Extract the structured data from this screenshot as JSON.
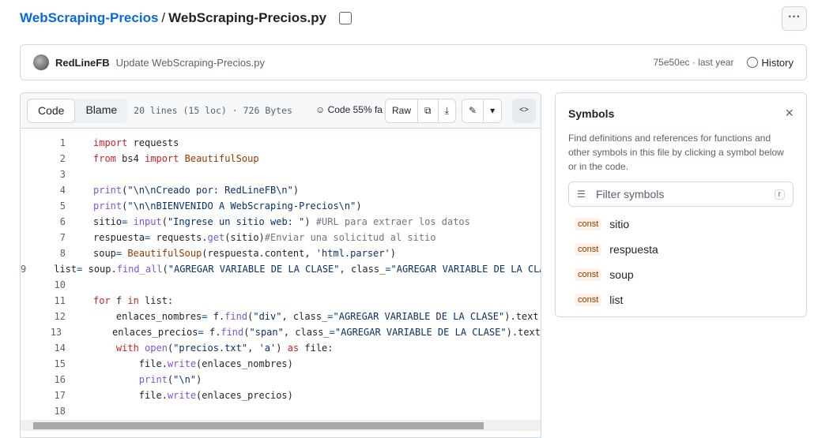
{
  "breadcrumb": {
    "repo": "WebScraping-Precios",
    "separator": "/",
    "file": "WebScraping-Precios.py"
  },
  "more_label": "···",
  "commit": {
    "author": "RedLineFB",
    "message": "Update WebScraping-Precios.py",
    "hash_time": "75e50ec · last year",
    "history": "History"
  },
  "toolbar": {
    "code_tab": "Code",
    "blame_tab": "Blame",
    "meta": "20 lines (15 loc) · 726 Bytes",
    "copilot": "Code 55% fa",
    "raw": "Raw",
    "overflow_text": "Co"
  },
  "code": [
    {
      "n": "1",
      "t": [
        [
          "import",
          "k"
        ],
        [
          " requests",
          ""
        ]
      ]
    },
    {
      "n": "2",
      "t": [
        [
          "from",
          "k"
        ],
        [
          " bs4 ",
          ""
        ],
        [
          "import",
          "k"
        ],
        [
          " ",
          ""
        ],
        [
          "BeautifulSoup",
          "c"
        ]
      ]
    },
    {
      "n": "3",
      "t": []
    },
    {
      "n": "4",
      "t": [
        [
          "print",
          "f"
        ],
        [
          "(",
          ""
        ],
        [
          "\"\\n\\nCreado por: RedLineFB\\n\"",
          "s"
        ],
        [
          ")",
          ""
        ]
      ]
    },
    {
      "n": "5",
      "t": [
        [
          "print",
          "f"
        ],
        [
          "(",
          ""
        ],
        [
          "\"\\n\\nBIENVENIDO A WebScraping-Precios\\n\"",
          "s"
        ],
        [
          ")",
          ""
        ]
      ]
    },
    {
      "n": "6",
      "t": [
        [
          "sitio",
          ""
        ],
        [
          "=",
          "o"
        ],
        [
          " ",
          ""
        ],
        [
          "input",
          "f"
        ],
        [
          "(",
          ""
        ],
        [
          "\"Ingrese un sitio web: \"",
          "s"
        ],
        [
          ") ",
          ""
        ],
        [
          "#URL para extraer los datos",
          "m"
        ]
      ]
    },
    {
      "n": "7",
      "t": [
        [
          "respuesta",
          ""
        ],
        [
          "=",
          "o"
        ],
        [
          " requests.",
          ""
        ],
        [
          "get",
          "f"
        ],
        [
          "(sitio)",
          ""
        ],
        [
          "#Enviar una solicitud al sitio",
          "m"
        ]
      ]
    },
    {
      "n": "8",
      "t": [
        [
          "soup",
          ""
        ],
        [
          "=",
          "o"
        ],
        [
          " ",
          ""
        ],
        [
          "BeautifulSoup",
          "c"
        ],
        [
          "(respuesta.content, ",
          ""
        ],
        [
          "'html.parser'",
          "s"
        ],
        [
          ")",
          ""
        ]
      ]
    },
    {
      "n": "9",
      "t": [
        [
          "list",
          ""
        ],
        [
          "=",
          "o"
        ],
        [
          " soup.",
          ""
        ],
        [
          "find_all",
          "f"
        ],
        [
          "(",
          ""
        ],
        [
          "\"AGREGAR VARIABLE DE LA CLASE\"",
          "s"
        ],
        [
          ", class_",
          ""
        ],
        [
          "=",
          "o"
        ],
        [
          "\"AGREGAR VARIABLE DE LA CLASE\")",
          "s"
        ]
      ]
    },
    {
      "n": "10",
      "t": []
    },
    {
      "n": "11",
      "t": [
        [
          "for",
          "k"
        ],
        [
          " f ",
          ""
        ],
        [
          "in",
          "k"
        ],
        [
          " list:",
          ""
        ]
      ]
    },
    {
      "n": "12",
      "t": [
        [
          "    enlaces_nombres",
          ""
        ],
        [
          "=",
          "o"
        ],
        [
          " f.",
          ""
        ],
        [
          "find",
          "f"
        ],
        [
          "(",
          ""
        ],
        [
          "\"div\"",
          "s"
        ],
        [
          ", class_",
          ""
        ],
        [
          "=",
          "o"
        ],
        [
          "\"AGREGAR VARIABLE DE LA CLASE\"",
          "s"
        ],
        [
          ").text",
          ""
        ]
      ]
    },
    {
      "n": "13",
      "t": [
        [
          "    enlaces_precios",
          ""
        ],
        [
          "=",
          "o"
        ],
        [
          " f.",
          ""
        ],
        [
          "find",
          "f"
        ],
        [
          "(",
          ""
        ],
        [
          "\"span\"",
          "s"
        ],
        [
          ", class_",
          ""
        ],
        [
          "=",
          "o"
        ],
        [
          "\"AGREGAR VARIABLE DE LA CLASE\"",
          "s"
        ],
        [
          ").text",
          ""
        ]
      ]
    },
    {
      "n": "14",
      "t": [
        [
          "    ",
          ""
        ],
        [
          "with",
          "k"
        ],
        [
          " ",
          ""
        ],
        [
          "open",
          "f"
        ],
        [
          "(",
          ""
        ],
        [
          "\"precios.txt\"",
          "s"
        ],
        [
          ", ",
          ""
        ],
        [
          "'a'",
          "s"
        ],
        [
          ") ",
          ""
        ],
        [
          "as",
          "k"
        ],
        [
          " file:",
          ""
        ]
      ]
    },
    {
      "n": "15",
      "t": [
        [
          "        file.",
          ""
        ],
        [
          "write",
          "f"
        ],
        [
          "(enlaces_nombres)",
          ""
        ]
      ]
    },
    {
      "n": "16",
      "t": [
        [
          "        ",
          ""
        ],
        [
          "print",
          "f"
        ],
        [
          "(",
          ""
        ],
        [
          "\"\\n\"",
          "s"
        ],
        [
          ")",
          ""
        ]
      ]
    },
    {
      "n": "17",
      "t": [
        [
          "        file.",
          ""
        ],
        [
          "write",
          "f"
        ],
        [
          "(enlaces_precios)",
          ""
        ]
      ]
    },
    {
      "n": "18",
      "t": []
    }
  ],
  "symbols": {
    "title": "Symbols",
    "close": "×",
    "description": "Find definitions and references for functions and other symbols in this file by clicking a symbol below or in the code.",
    "filter_placeholder": "Filter symbols",
    "shortcut": "r",
    "items": [
      {
        "kind": "const",
        "name": "sitio"
      },
      {
        "kind": "const",
        "name": "respuesta"
      },
      {
        "kind": "const",
        "name": "soup"
      },
      {
        "kind": "const",
        "name": "list"
      }
    ]
  }
}
